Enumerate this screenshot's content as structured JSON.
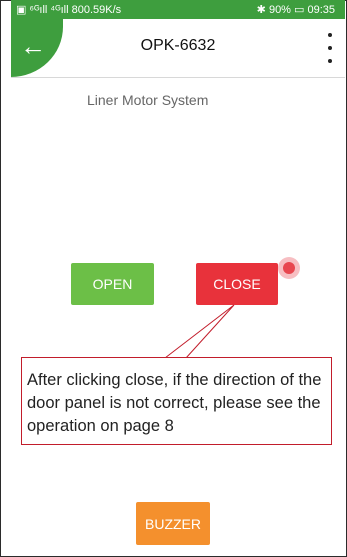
{
  "status_bar": {
    "left": "▣ ⁶ᴳıll ⁴ᴳıll 800.59K/s",
    "right": "✱ 90% ▭ 09:35"
  },
  "header": {
    "title": "OPK-6632"
  },
  "content": {
    "subtitle": "Liner Motor System",
    "open_label": "OPEN",
    "close_label": "CLOSE",
    "buzzer_label": "BUZZER"
  },
  "annotation": {
    "text": "After clicking close, if the direction of the door panel is not correct, please see the operation on page 8"
  },
  "colors": {
    "header_green": "#3e9e3e",
    "open": "#6cbf47",
    "close": "#e8323b",
    "buzzer": "#f4902d",
    "annotation_border": "#c21d2b"
  }
}
